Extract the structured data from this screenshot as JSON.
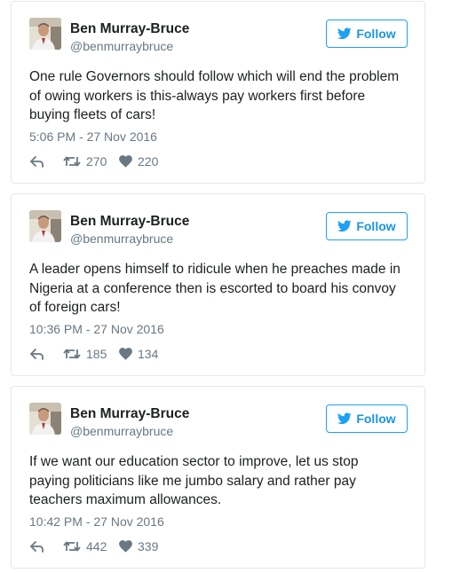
{
  "colors": {
    "accent": "#1da1f2",
    "name": "#1c2022",
    "meta": "#697882",
    "border": "#e1e8ed"
  },
  "tweets": [
    {
      "author": "Ben Murray-Bruce",
      "handle": "@benmurraybruce",
      "follow_label": "Follow",
      "text": "One rule Governors should follow which will end the problem of owing workers is this-always pay workers first before buying fleets of cars!",
      "timestamp": "5:06 PM - 27 Nov 2016",
      "retweets": "270",
      "likes": "220"
    },
    {
      "author": "Ben Murray-Bruce",
      "handle": "@benmurraybruce",
      "follow_label": "Follow",
      "text": "A leader opens himself to ridicule when he preaches made in Nigeria at a conference then is escorted to board his convoy of foreign cars!",
      "timestamp": "10:36 PM - 27 Nov 2016",
      "retweets": "185",
      "likes": "134"
    },
    {
      "author": "Ben Murray-Bruce",
      "handle": "@benmurraybruce",
      "follow_label": "Follow",
      "text": "If we want our education sector to improve, let us stop paying politicians like me jumbo salary and rather pay teachers maximum allowances.",
      "timestamp": "10:42 PM - 27 Nov 2016",
      "retweets": "442",
      "likes": "339"
    }
  ]
}
